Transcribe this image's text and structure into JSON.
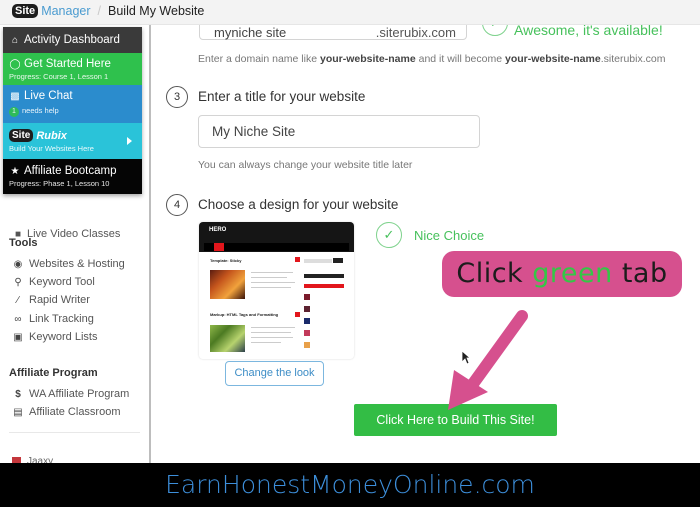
{
  "breadcrumb": {
    "site_badge": "Site",
    "manager": "Manager",
    "separator": "/",
    "current": "Build My Website"
  },
  "sidebar_menu": {
    "activity": {
      "icon": "home-icon",
      "label": "Activity Dashboard"
    },
    "get_started": {
      "icon": "play-circle-icon",
      "label": "Get Started Here",
      "sub": "Progress: Course 1, Lesson 1"
    },
    "live_chat": {
      "icon": "chat-icon",
      "label": "Live Chat",
      "badge": "1",
      "sub": "needs help"
    },
    "siterubix": {
      "badge": "Site",
      "label": "Rubix",
      "sub": "Build Your Websites Here"
    },
    "bootcamp": {
      "icon": "star-icon",
      "label": "Affiliate Bootcamp",
      "sub": "Progress: Phase 1, Lesson 10"
    }
  },
  "sidebar": {
    "live_video": "Live Video Classes",
    "tools_heading": "Tools",
    "tools": [
      {
        "icon": "globe-icon",
        "label": "Websites & Hosting"
      },
      {
        "icon": "search-icon",
        "label": "Keyword Tool"
      },
      {
        "icon": "pen-icon",
        "label": "Rapid Writer"
      },
      {
        "icon": "link-icon",
        "label": "Link Tracking"
      },
      {
        "icon": "stack-icon",
        "label": "Keyword Lists"
      }
    ],
    "affiliate_heading": "Affiliate Program",
    "affiliate": [
      {
        "icon": "dollar-icon",
        "label": "WA Affiliate Program"
      },
      {
        "icon": "book-icon",
        "label": "Affiliate Classroom"
      }
    ],
    "jaaxy": "Jaaxy"
  },
  "main": {
    "domain_value": "myniche site",
    "domain_suffix": ".siterubix.com",
    "domain_status": "Awesome, it's available!",
    "domain_hint_prefix": "Enter a domain name like ",
    "domain_hint_bold1": "your-website-name",
    "domain_hint_mid": " and it will become ",
    "domain_hint_bold2": "your-website-name",
    "domain_hint_suffix": ".siterubix.com",
    "step3_num": "3",
    "step3_title": "Enter a title for your website",
    "title_value": "My Niche Site",
    "title_hint": "You can always change your website title later",
    "step4_num": "4",
    "step4_title": "Choose a design for your website",
    "theme_name": "HERO",
    "theme_post1": "Template: Sticky",
    "theme_post2": "Markup: HTML Tags and Formatting",
    "nice_choice": "Nice Choice",
    "change_look": "Change the look",
    "build_button": "Click Here to Build This Site!"
  },
  "annotation": {
    "prefix": "Click ",
    "highlight": "green",
    "suffix": " tab"
  },
  "footer": {
    "text": "EarnHonestMoneyOnline.com"
  },
  "colors": {
    "green_accent": "#33bd45",
    "callout_pink": "#d6508e",
    "link_blue": "#3d8dc6",
    "footer_blue": "#3d8fdb"
  }
}
